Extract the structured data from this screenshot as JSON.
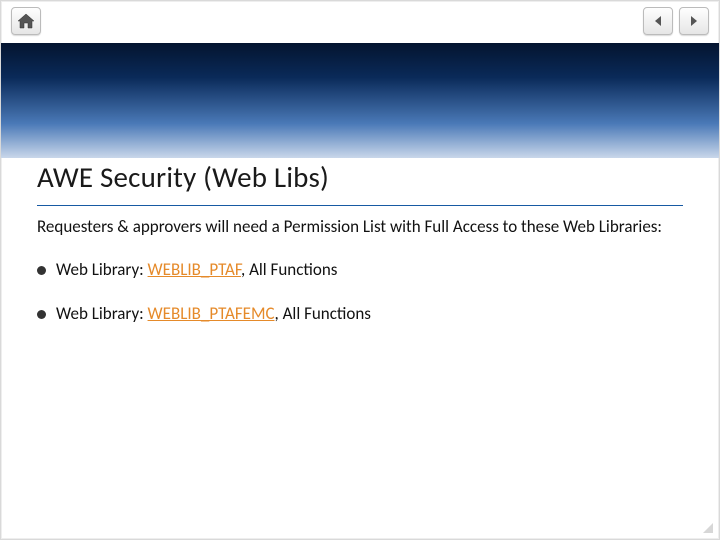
{
  "toolbar": {
    "home_icon": "home",
    "nav_back_icon": "triangle-left",
    "nav_fwd_icon": "triangle-right"
  },
  "title": "AWE Security (Web Libs)",
  "intro": "Requesters & approvers will need a Permission List with Full Access to these Web Libraries:",
  "bullets": [
    {
      "prefix": "Web Library: ",
      "lib": "WEBLIB_PTAF",
      "suffix": ", All Functions"
    },
    {
      "prefix": "Web Library: ",
      "lib": "WEBLIB_PTAFEMC",
      "suffix": ", All Functions"
    }
  ]
}
